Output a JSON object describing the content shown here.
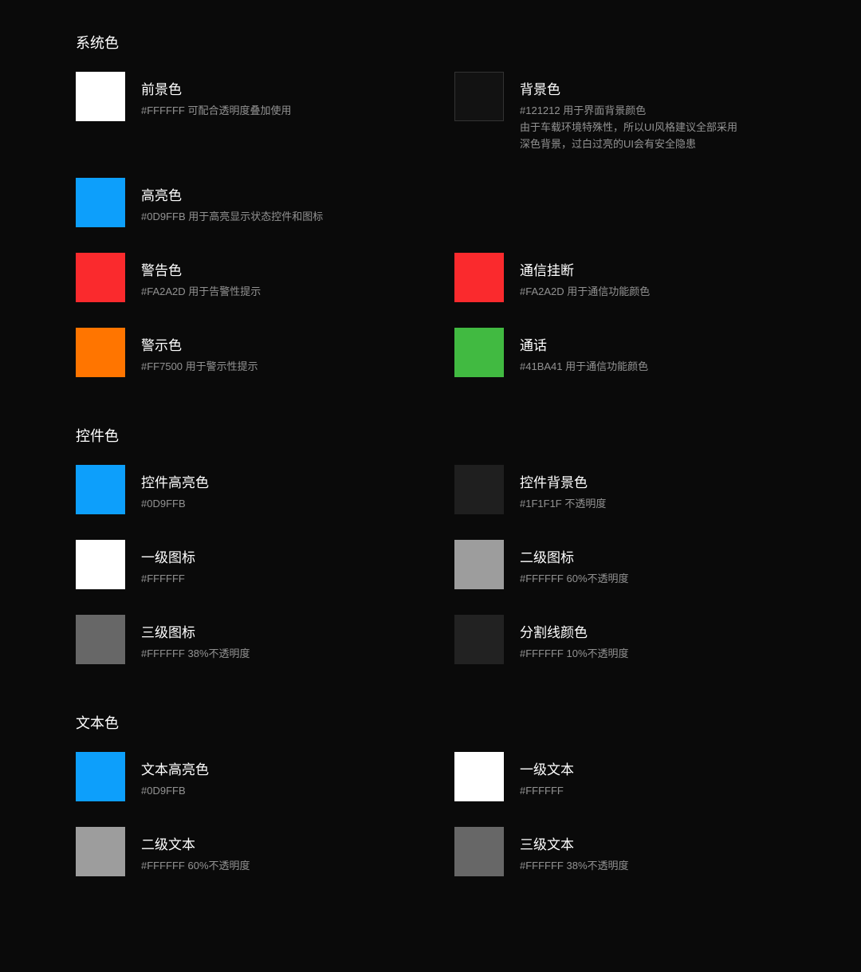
{
  "sections": [
    {
      "title": "系统色",
      "items": [
        {
          "label": "前景色",
          "desc": "#FFFFFF 可配合透明度叠加使用",
          "color": "#FFFFFF",
          "border": false
        },
        {
          "label": "背景色",
          "desc": "#121212 用于界面背景颜色\n由于车载环境特殊性，所以UI风格建议全部采用深色背景，过白过亮的UI会有安全隐患",
          "color": "#121212",
          "border": true
        },
        {
          "label": "高亮色",
          "desc": "#0D9FFB 用于高亮显示状态控件和图标",
          "color": "#0D9FFB",
          "border": false
        },
        {
          "label": "",
          "desc": "",
          "color": "",
          "border": false,
          "empty": true
        },
        {
          "label": "警告色",
          "desc": "#FA2A2D 用于告警性提示",
          "color": "#FA2A2D",
          "border": false
        },
        {
          "label": "通信挂断",
          "desc": "#FA2A2D 用于通信功能颜色",
          "color": "#FA2A2D",
          "border": false
        },
        {
          "label": "警示色",
          "desc": "#FF7500 用于警示性提示",
          "color": "#FF7500",
          "border": false
        },
        {
          "label": "通话",
          "desc": "#41BA41 用于通信功能颜色",
          "color": "#41BA41",
          "border": false
        }
      ]
    },
    {
      "title": "控件色",
      "items": [
        {
          "label": "控件高亮色",
          "desc": "#0D9FFB",
          "color": "#0D9FFB",
          "border": false
        },
        {
          "label": "控件背景色",
          "desc": "#1F1F1F 不透明度",
          "color": "#1F1F1F",
          "border": false
        },
        {
          "label": "一级图标",
          "desc": "#FFFFFF",
          "color": "#FFFFFF",
          "border": false
        },
        {
          "label": "二级图标",
          "desc": "#FFFFFF 60%不透明度",
          "color": "rgba(255,255,255,0.60)",
          "border": false
        },
        {
          "label": "三级图标",
          "desc": "#FFFFFF 38%不透明度",
          "color": "rgba(255,255,255,0.38)",
          "border": false
        },
        {
          "label": "分割线颜色",
          "desc": "#FFFFFF 10%不透明度",
          "color": "rgba(255,255,255,0.10)",
          "border": false
        }
      ]
    },
    {
      "title": "文本色",
      "items": [
        {
          "label": "文本高亮色",
          "desc": "#0D9FFB",
          "color": "#0D9FFB",
          "border": false
        },
        {
          "label": "一级文本",
          "desc": "#FFFFFF",
          "color": "#FFFFFF",
          "border": false
        },
        {
          "label": "二级文本",
          "desc": "#FFFFFF 60%不透明度",
          "color": "rgba(255,255,255,0.60)",
          "border": false
        },
        {
          "label": "三级文本",
          "desc": "#FFFFFF 38%不透明度",
          "color": "rgba(255,255,255,0.38)",
          "border": false
        }
      ]
    }
  ]
}
